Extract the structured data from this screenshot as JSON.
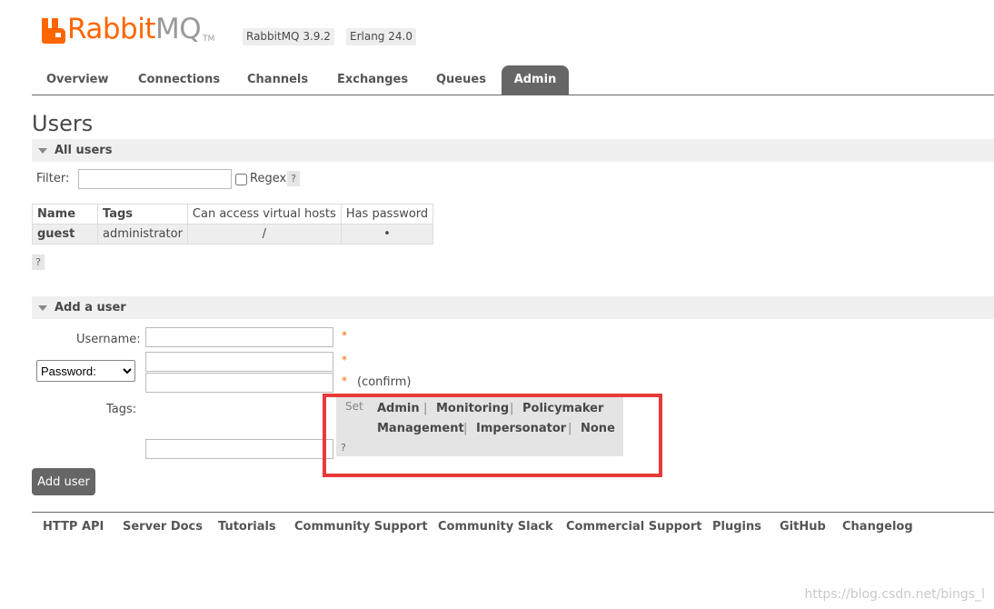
{
  "header": {
    "logo_prefix": "Rabbit",
    "logo_suffix": "MQ",
    "logo_tm": "TM",
    "version_rabbitmq": "RabbitMQ 3.9.2",
    "version_erlang": "Erlang 24.0",
    "brand_color": "#ff6600"
  },
  "tabs": [
    {
      "label": "Overview"
    },
    {
      "label": "Connections"
    },
    {
      "label": "Channels"
    },
    {
      "label": "Exchanges"
    },
    {
      "label": "Queues"
    },
    {
      "label": "Admin",
      "active": true
    }
  ],
  "page_title": "Users",
  "all_users": {
    "heading": "All users",
    "filter_label": "Filter:",
    "filter_value": "",
    "regex_label": "Regex",
    "regex_checked": false,
    "help": "?",
    "table": {
      "headers": [
        "Name",
        "Tags",
        "Can access virtual hosts",
        "Has password"
      ],
      "rows": [
        {
          "name": "guest",
          "tags": "administrator",
          "vhosts": "/",
          "has_password": "•"
        }
      ]
    },
    "table_help": "?"
  },
  "add_user": {
    "heading": "Add a user",
    "username_label": "Username:",
    "username_value": "",
    "password_type_options": [
      "Password:"
    ],
    "password_type_selected": "Password:",
    "password_value": "",
    "confirm_value": "",
    "required_marker": "*",
    "confirm_label": "(confirm)",
    "tags_label": "Tags:",
    "tags_value": "",
    "tags_set_label": "Set",
    "tag_options": [
      "Admin",
      "Monitoring",
      "Policymaker",
      "Management",
      "Impersonator",
      "None"
    ],
    "separator": "|",
    "tags_help": "?",
    "submit_label": "Add user"
  },
  "footer": {
    "links": [
      "HTTP API",
      "Server Docs",
      "Tutorials",
      "Community Support",
      "Community Slack",
      "Commercial Support",
      "Plugins",
      "GitHub",
      "Changelog"
    ]
  },
  "watermark": "https://blog.csdn.net/bings_l",
  "annotation": {
    "highlight_color": "#e83a3a"
  }
}
